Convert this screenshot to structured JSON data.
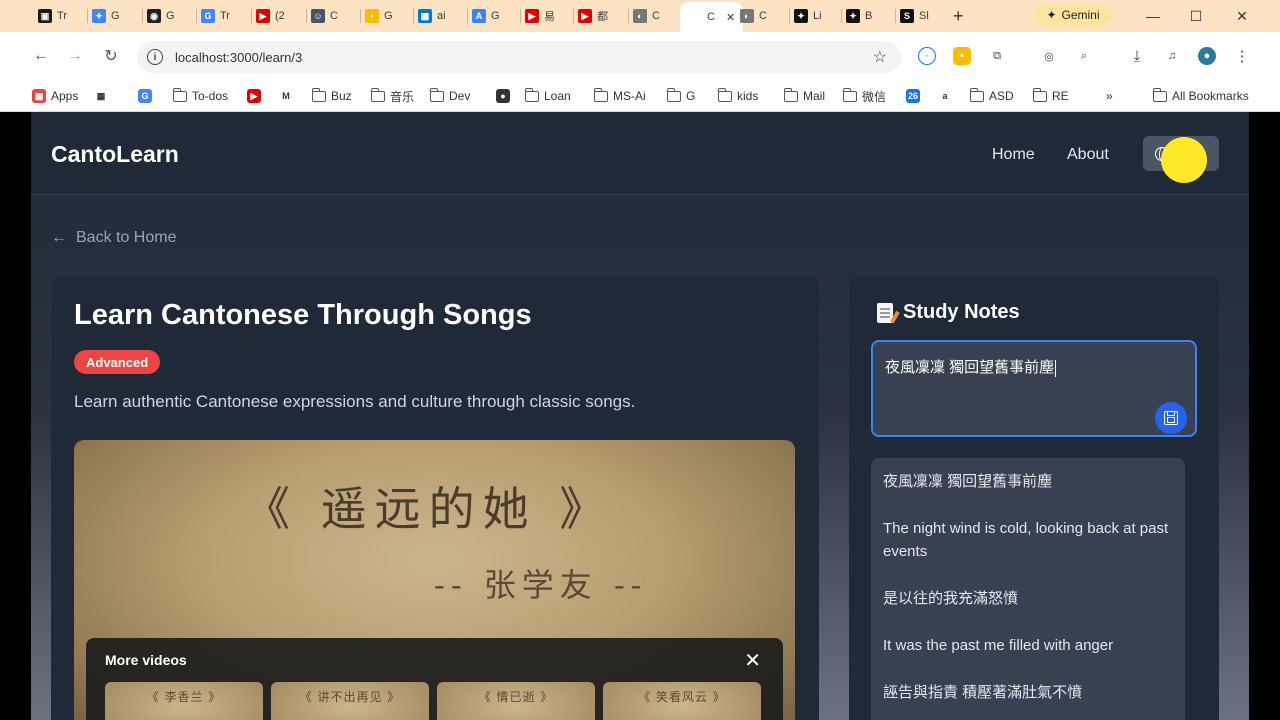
{
  "browser": {
    "tabs": [
      {
        "label": "Tr",
        "fav_color": "#1a1a1a",
        "fav_glyph": "▣"
      },
      {
        "label": "G",
        "fav_color": "#4285f4",
        "fav_glyph": "✦"
      },
      {
        "label": "G",
        "fav_color": "#222222",
        "fav_glyph": "◉"
      },
      {
        "label": "Tr",
        "fav_color": "#4285f4",
        "fav_glyph": "G"
      },
      {
        "label": "(2",
        "fav_color": "#e00000",
        "fav_glyph": "▶"
      },
      {
        "label": "C",
        "fav_color": "#445566",
        "fav_glyph": "☺"
      },
      {
        "label": "G",
        "fav_color": "#fbbc04",
        "fav_glyph": "▪"
      },
      {
        "label": "ai",
        "fav_color": "#0078d4",
        "fav_glyph": "▦"
      },
      {
        "label": "G",
        "fav_color": "#3b82f6",
        "fav_glyph": "A"
      },
      {
        "label": "易",
        "fav_color": "#e00000",
        "fav_glyph": "▶"
      },
      {
        "label": "都",
        "fav_color": "#e00000",
        "fav_glyph": "▶"
      },
      {
        "label": "C",
        "fav_color": "#777777",
        "fav_glyph": "◐"
      },
      {
        "label": "C",
        "fav_color": "#ffffff",
        "fav_glyph": ""
      },
      {
        "label": "C",
        "fav_color": "#777777",
        "fav_glyph": "◐"
      },
      {
        "label": "Li",
        "fav_color": "#111111",
        "fav_glyph": "✦"
      },
      {
        "label": "B",
        "fav_color": "#111111",
        "fav_glyph": "✦"
      },
      {
        "label": "Sl",
        "fav_color": "#111111",
        "fav_glyph": "S"
      }
    ],
    "new_tab": "+",
    "gemini_label": "Gemini",
    "url": "localhost:3000/learn/3",
    "bookmarks": [
      {
        "label": "Apps",
        "type": "apps"
      },
      {
        "label": "",
        "type": "grid"
      },
      {
        "label": "",
        "type": "translate"
      },
      {
        "label": "To-dos",
        "type": "folder"
      },
      {
        "label": "",
        "type": "youtube"
      },
      {
        "label": "",
        "type": "gmail"
      },
      {
        "label": "Buz",
        "type": "folder"
      },
      {
        "label": "音乐",
        "type": "folder"
      },
      {
        "label": "Dev",
        "type": "folder"
      },
      {
        "label": "",
        "type": "globe"
      },
      {
        "label": "Loan",
        "type": "folder"
      },
      {
        "label": "MS-Ai",
        "type": "folder"
      },
      {
        "label": "G",
        "type": "folder"
      },
      {
        "label": "kids",
        "type": "folder"
      },
      {
        "label": "Mail",
        "type": "folder"
      },
      {
        "label": "微信",
        "type": "folder"
      },
      {
        "label": "",
        "type": "calendar"
      },
      {
        "label": "",
        "type": "amazon"
      },
      {
        "label": "ASD",
        "type": "folder"
      },
      {
        "label": "RE",
        "type": "folder"
      },
      {
        "label": "»",
        "type": "more"
      },
      {
        "label": "All Bookmarks",
        "type": "folder"
      }
    ]
  },
  "app": {
    "brand": "CantoLearn",
    "nav": {
      "home": "Home",
      "about": "About"
    },
    "back_label": "Back to Home",
    "lesson": {
      "title": "Learn Cantonese Through Songs",
      "level": "Advanced",
      "description": "Learn authentic Cantonese expressions and culture through classic songs."
    },
    "video": {
      "title_text": "《 遥远的她 》",
      "artist_text": "-- 张学友 --",
      "more_videos_label": "More videos",
      "thumbnails": [
        "《 李香兰 》",
        "《 讲不出再见 》",
        "《 情已逝 》",
        "《 笑看风云 》"
      ]
    },
    "notes": {
      "title": "Study Notes",
      "input_value": "夜風凜凜 獨回望舊事前塵",
      "saved_lines": [
        "夜風凜凜 獨回望舊事前塵",
        "The night wind is cold, looking back at past events",
        "是以往的我充滿怒憤",
        "It was the past me filled with anger",
        "誣告與指責 積壓著滿肚氣不憤"
      ]
    }
  },
  "colors": {
    "accent": "#3b82f6",
    "badge": "#ef4444",
    "card": "#1f2937",
    "cursor_highlight": "#fde92a"
  }
}
